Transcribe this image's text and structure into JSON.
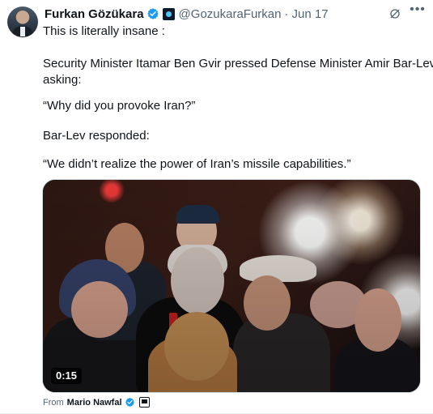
{
  "post": {
    "author_name": "Furkan Gözükara",
    "handle": "@GozukaraFurkan",
    "separator": "·",
    "date": "Jun 17",
    "more_label": "•••",
    "lines": [
      "This is literally insane :",
      " Security Minister Itamar Ben Gvir pressed Defense Minister Amir Bar-Lev,",
      "asking:",
      "“Why did you provoke Iran?”",
      "Bar-Lev responded:",
      "“We didn’t realize the power of Iran’s missile capabilities.”"
    ]
  },
  "media": {
    "duration": "0:15"
  },
  "source": {
    "prefix": "From",
    "name": "Mario Nawfal"
  },
  "colors": {
    "text": "#0f1419",
    "secondary_text": "#536471",
    "verified": "#1d9bf0",
    "border": "#cfd9de"
  },
  "icons": [
    "verified-badge-icon",
    "affiliate-badge-icon",
    "grok-icon",
    "more-options-icon",
    "source-badge-icon"
  ]
}
